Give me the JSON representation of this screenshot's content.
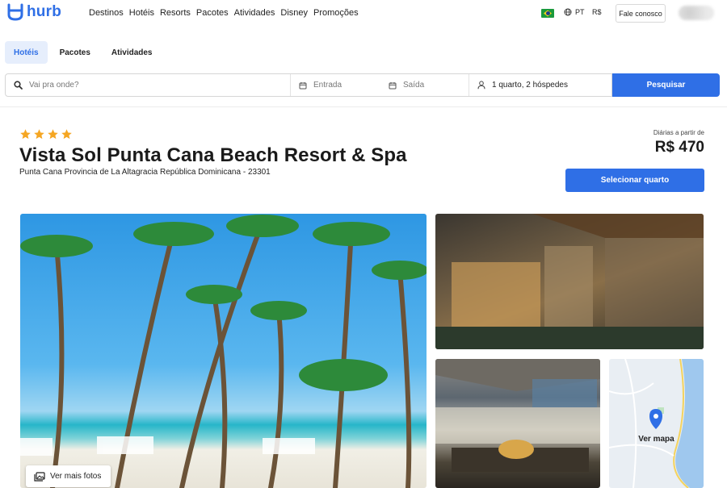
{
  "brand": {
    "name": "hurb",
    "color": "#2f6fe6"
  },
  "nav": {
    "items": [
      "Destinos",
      "Hotéis",
      "Resorts",
      "Pacotes",
      "Atividades",
      "Disney",
      "Promoções"
    ]
  },
  "locale": {
    "language": "PT",
    "currency": "R$"
  },
  "header": {
    "contact_label": "Fale conosco"
  },
  "product_tabs": {
    "items": [
      "Hotéis",
      "Pacotes",
      "Atividades"
    ],
    "active": "Hotéis"
  },
  "search": {
    "destination_placeholder": "Vai pra onde?",
    "checkin_placeholder": "Entrada",
    "checkout_placeholder": "Saída",
    "guests_value": "1 quarto, 2 hóspedes",
    "submit_label": "Pesquisar"
  },
  "hotel": {
    "stars": 4,
    "star_color": "#f5a623",
    "name": "Vista Sol Punta Cana Beach Resort & Spa",
    "address": "Punta Cana Provincia de La Altagracia República Dominicana - 23301",
    "price_caption": "Diárias a partir de",
    "price": "R$ 470",
    "select_label": "Selecionar quarto"
  },
  "gallery": {
    "more_photos_label": "Ver mais fotos",
    "map_label": "Ver mapa"
  }
}
